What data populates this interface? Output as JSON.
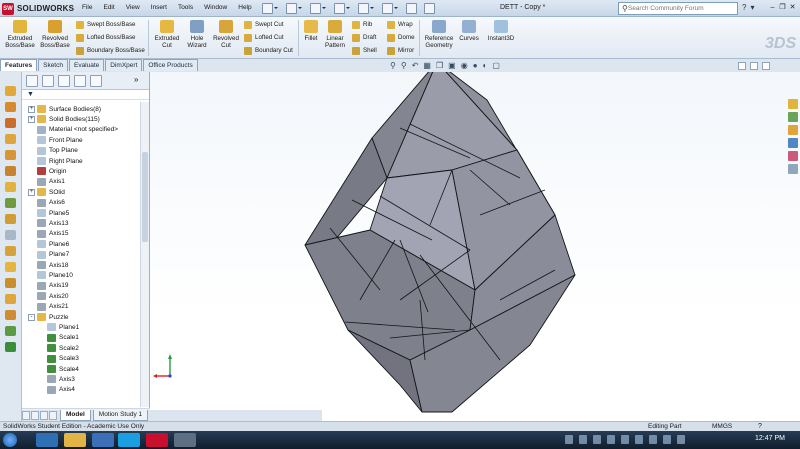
{
  "app": {
    "brand": "SOLIDWORKS",
    "logo_mark": "SW",
    "document_title": "DETT - Copy *",
    "menus": [
      "File",
      "Edit",
      "View",
      "Insert",
      "Tools",
      "Window",
      "Help"
    ],
    "search_placeholder": "Search Community Forum",
    "watermark": "3DS"
  },
  "ribbon": {
    "extruded_boss": "Extruded\nBoss/Base",
    "revolved_boss": "Revolved\nBoss/Base",
    "swept_boss": "Swept Boss/Base",
    "lofted_boss": "Lofted Boss/Base",
    "boundary_boss": "Boundary Boss/Base",
    "extruded_cut": "Extruded\nCut",
    "hole_wizard": "Hole\nWizard",
    "revolved_cut": "Revolved\nCut",
    "swept_cut": "Swept Cut",
    "lofted_cut": "Lofted Cut",
    "boundary_cut": "Boundary Cut",
    "fillet": "Fillet",
    "linear_pattern": "Linear\nPattern",
    "rib": "Rib",
    "draft": "Draft",
    "shell": "Shell",
    "wrap": "Wrap",
    "dome": "Dome",
    "mirror": "Mirror",
    "reference_geometry": "Reference\nGeometry",
    "curves": "Curves",
    "instant3d": "Instant3D"
  },
  "tabs": [
    "Features",
    "Sketch",
    "Evaluate",
    "DimXpert",
    "Office Products"
  ],
  "tree": [
    {
      "label": "Surface Bodies(8)",
      "exp": "+",
      "icon": "folder-icon"
    },
    {
      "label": "Solid Bodies(115)",
      "exp": "+",
      "icon": "folder-icon"
    },
    {
      "label": "Material <not specified>",
      "exp": "",
      "icon": "material-icon"
    },
    {
      "label": "Front Plane",
      "exp": "",
      "icon": "plane-icon"
    },
    {
      "label": "Top Plane",
      "exp": "",
      "icon": "plane-icon"
    },
    {
      "label": "Right Plane",
      "exp": "",
      "icon": "plane-icon"
    },
    {
      "label": "Origin",
      "exp": "",
      "icon": "origin-icon"
    },
    {
      "label": "Axis1",
      "exp": "",
      "icon": "axis-icon"
    },
    {
      "label": "SOlid",
      "exp": "+",
      "icon": "folder-icon"
    },
    {
      "label": "Axis6",
      "exp": "",
      "icon": "axis-icon"
    },
    {
      "label": "Plane5",
      "exp": "",
      "icon": "plane-icon"
    },
    {
      "label": "Axis13",
      "exp": "",
      "icon": "axis-icon"
    },
    {
      "label": "Axis15",
      "exp": "",
      "icon": "axis-icon"
    },
    {
      "label": "Plane6",
      "exp": "",
      "icon": "plane-icon"
    },
    {
      "label": "Plane7",
      "exp": "",
      "icon": "plane-icon"
    },
    {
      "label": "Axis18",
      "exp": "",
      "icon": "axis-icon"
    },
    {
      "label": "Plane10",
      "exp": "",
      "icon": "plane-icon"
    },
    {
      "label": "Axis19",
      "exp": "",
      "icon": "axis-icon"
    },
    {
      "label": "Axis20",
      "exp": "",
      "icon": "axis-icon"
    },
    {
      "label": "Axis21",
      "exp": "",
      "icon": "axis-icon"
    },
    {
      "label": "Puzzle",
      "exp": "-",
      "icon": "folder-icon"
    },
    {
      "label": "Plane1",
      "exp": "",
      "icon": "plane-icon",
      "indent": 1
    },
    {
      "label": "Scale1",
      "exp": "",
      "icon": "scale-icon",
      "indent": 1
    },
    {
      "label": "Scale2",
      "exp": "",
      "icon": "scale-icon",
      "indent": 1
    },
    {
      "label": "Scale3",
      "exp": "",
      "icon": "scale-icon",
      "indent": 1
    },
    {
      "label": "Scale4",
      "exp": "",
      "icon": "scale-icon",
      "indent": 1
    },
    {
      "label": "Axis3",
      "exp": "",
      "icon": "axis-icon",
      "indent": 1
    },
    {
      "label": "Axis4",
      "exp": "",
      "icon": "axis-icon",
      "indent": 1
    }
  ],
  "model_tabs": [
    "Model",
    "Motion Study 1"
  ],
  "status": {
    "left": "SolidWorks Student Edition - Academic Use Only",
    "mode": "Editing Part",
    "units": "MMGS"
  },
  "taskbar": {
    "clock": "12:47 PM"
  },
  "colors": {
    "model_face": "#9a9caa",
    "model_edge": "#141418",
    "accent": "#c8102e"
  }
}
